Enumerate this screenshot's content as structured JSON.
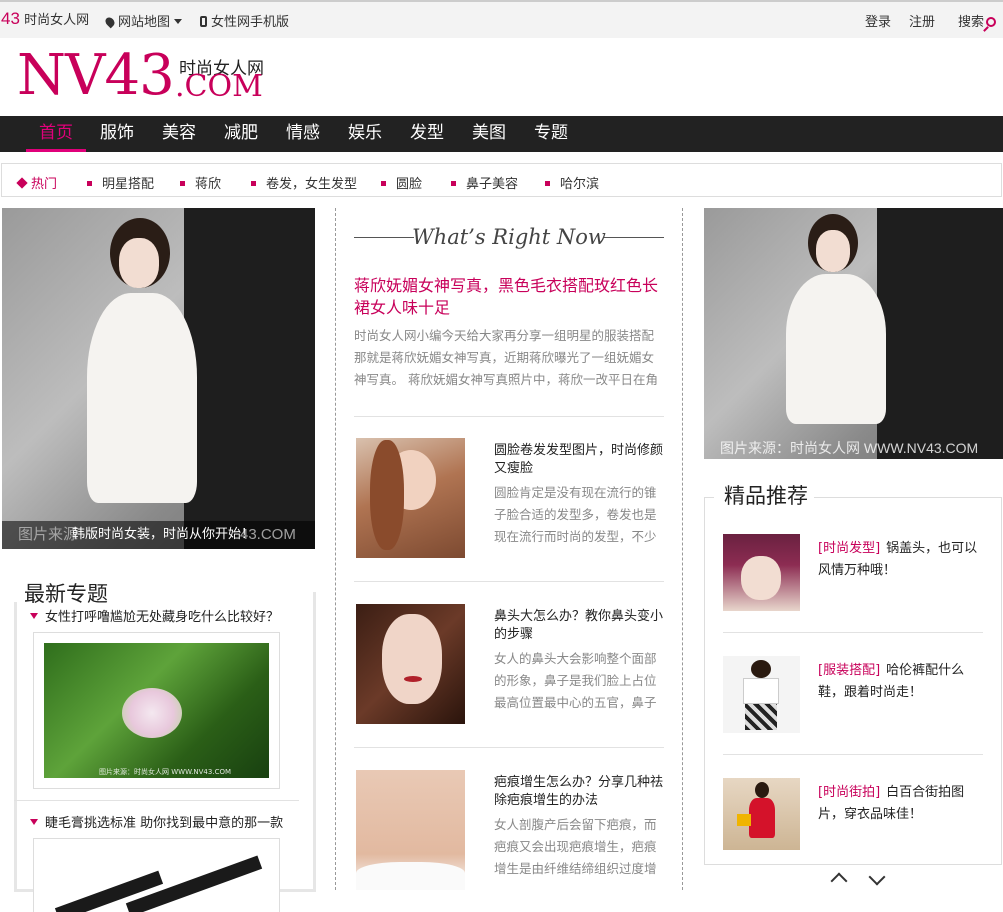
{
  "topbar": {
    "site_num": "43",
    "site_name": "时尚女人网",
    "sitemap": "网站地图",
    "mobile": "女性网手机版",
    "login": "登录",
    "register": "注册",
    "search": "搜索"
  },
  "logo": {
    "main": "NV43",
    "cn": "时尚女人网",
    "com": ".COM"
  },
  "nav": [
    "首页",
    "服饰",
    "美容",
    "减肥",
    "情感",
    "娱乐",
    "发型",
    "美图",
    "专题"
  ],
  "hot": {
    "label": "热门",
    "items": [
      "明星搭配",
      "蒋欣",
      "卷发，女生发型",
      "圆脸",
      "鼻子美容",
      "哈尔滨"
    ]
  },
  "left_feature": {
    "caption": "韩版时尚女装，时尚从你开始！",
    "watermark": "图片来源",
    "watermark2": "43.COM"
  },
  "center": {
    "heading": "What’s Right Now",
    "lead_title": "蒋欣妩媚女神写真，黑色毛衣搭配玫红色长裙女人味十足",
    "lead_text": "时尚女人网小编今天给大家再分享一组明星的服装搭配那就是蒋欣妩媚女神写真，近期蒋欣曝光了一组妩媚女神写真。 蒋欣妩媚女神写真照片中，蒋欣一改平日在角色中",
    "articles": [
      {
        "title": "圆脸卷发发型图片，时尚修颜又瘦脸",
        "text": "圆脸肯定是没有现在流行的锥子脸合适的发型多，卷发也是现在流行而时尚的发型，不少圆脸的"
      },
      {
        "title": "鼻头大怎么办？教你鼻头变小的步骤",
        "text": "女人的鼻头大会影响整个面部的形象，鼻子是我们脸上占位最高位置最中心的五官，鼻子如果太"
      },
      {
        "title": "疤痕增生怎么办？分享几种祛除疤痕增生的办法",
        "text": "女人剖腹产后会留下疤痕，而疤痕又会出现疤痕增生，疤痕增生是由纤维结缔组织过度增生引起"
      }
    ]
  },
  "right_feature": {
    "watermark": "图片来源：时尚女人网 WWW.NV43.COM"
  },
  "latest_topics": {
    "heading": "最新专题",
    "items": [
      {
        "title": "女性打呼噜尴尬无处藏身吃什么比较好？",
        "img_watermark": "图片来源：时尚女人网 WWW.NV43.COM"
      },
      {
        "title": "睫毛膏挑选标准 助你找到最中意的那一款",
        "img_watermark": ""
      }
    ]
  },
  "recommended": {
    "heading": "精品推荐",
    "items": [
      {
        "category": "[时尚发型]",
        "text": "锅盖头，也可以风情万种哦！"
      },
      {
        "category": "[服装搭配]",
        "text": "哈伦裤配什么鞋，跟着时尚走！"
      },
      {
        "category": "[时尚街拍]",
        "text": "白百合街拍图片，穿衣品味佳！"
      }
    ]
  },
  "colors": {
    "accent": "#c8005a",
    "nav_bg": "#222222",
    "nav_active": "#e0007a"
  }
}
